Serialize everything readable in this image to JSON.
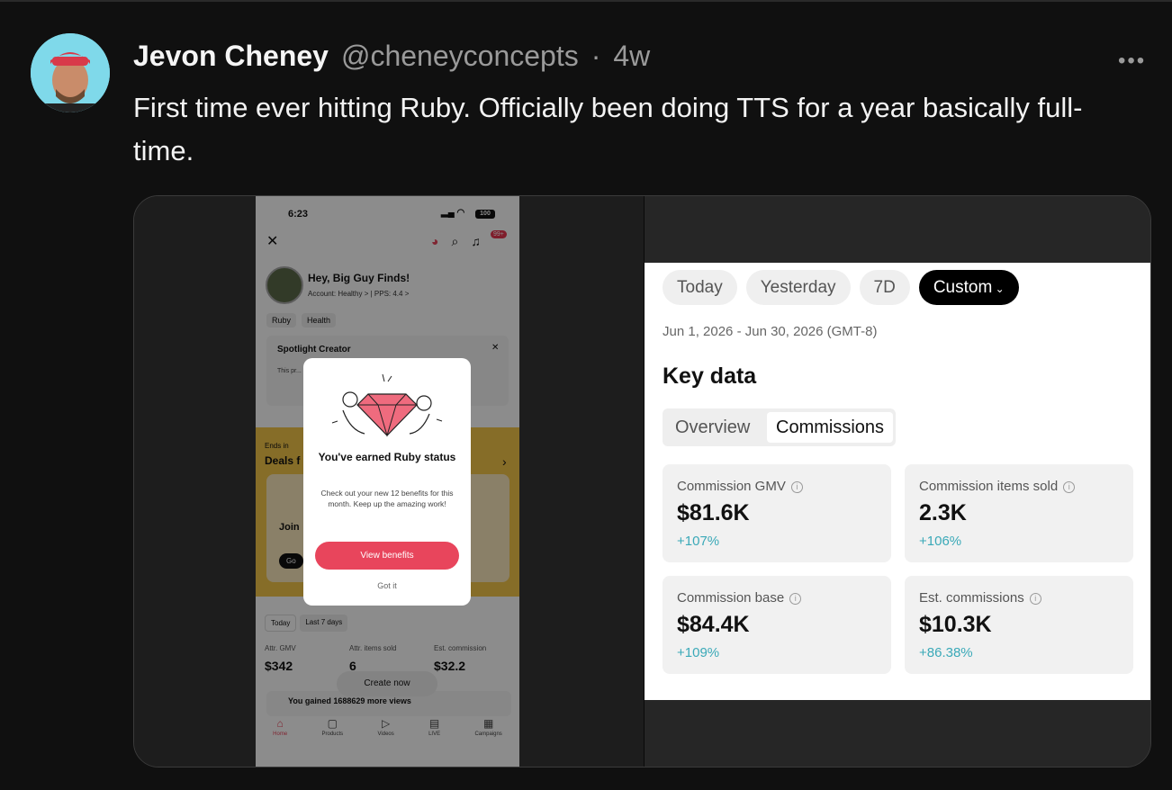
{
  "post": {
    "author": "Jevon Cheney",
    "handle": "@cheneyconcepts",
    "separator": "·",
    "age": "4w",
    "more_label": "•••",
    "text": "First time ever hitting Ruby. Officially been doing TTS for a year basically full-time."
  },
  "phone": {
    "status_time": "6:23",
    "battery": "100",
    "notif_badge": "99+",
    "greeting": "Hey, Big Guy Finds!",
    "account_line": "Account: Healthy >  |  PPS: 4.4 >",
    "chips": [
      "Ruby",
      "Health"
    ],
    "spotlight_title": "Spotlight Creator",
    "spotlight_body": "This pr... creato...",
    "ends_in": "Ends in",
    "deals_title": "Deals f",
    "join_label": "Join",
    "go_label": "Go",
    "tabs": [
      "Today",
      "Last 7 days"
    ],
    "stats": [
      {
        "label": "Attr. GMV",
        "value": "$342"
      },
      {
        "label": "Attr. items sold",
        "value": "6"
      },
      {
        "label": "Est. commission",
        "value": "$32.2"
      }
    ],
    "create_now": "Create now",
    "gained_text": "You gained 1688629 more views",
    "nav": [
      "Home",
      "Products",
      "Videos",
      "LIVE",
      "Campaigns"
    ],
    "modal": {
      "title": "You've earned Ruby status",
      "body": "Check out your new 12 benefits for this month. Keep up the amazing work!",
      "primary": "View benefits",
      "secondary": "Got it"
    }
  },
  "dashboard": {
    "pills": [
      "Today",
      "Yesterday",
      "7D",
      "Custom"
    ],
    "date_range": "Jun 1, 2026 - Jun 30, 2026 (GMT-8)",
    "section_title": "Key data",
    "segments": [
      "Overview",
      "Commissions"
    ],
    "cards": [
      {
        "label": "Commission GMV",
        "value": "$81.6K",
        "delta": "+107%"
      },
      {
        "label": "Commission items sold",
        "value": "2.3K",
        "delta": "+106%"
      },
      {
        "label": "Commission base",
        "value": "$84.4K",
        "delta": "+109%"
      },
      {
        "label": "Est. commissions",
        "value": "$10.3K",
        "delta": "+86.38%"
      }
    ]
  },
  "colors": {
    "background": "#101010",
    "ruby": "#e8455c",
    "delta": "#3aa9b8"
  }
}
